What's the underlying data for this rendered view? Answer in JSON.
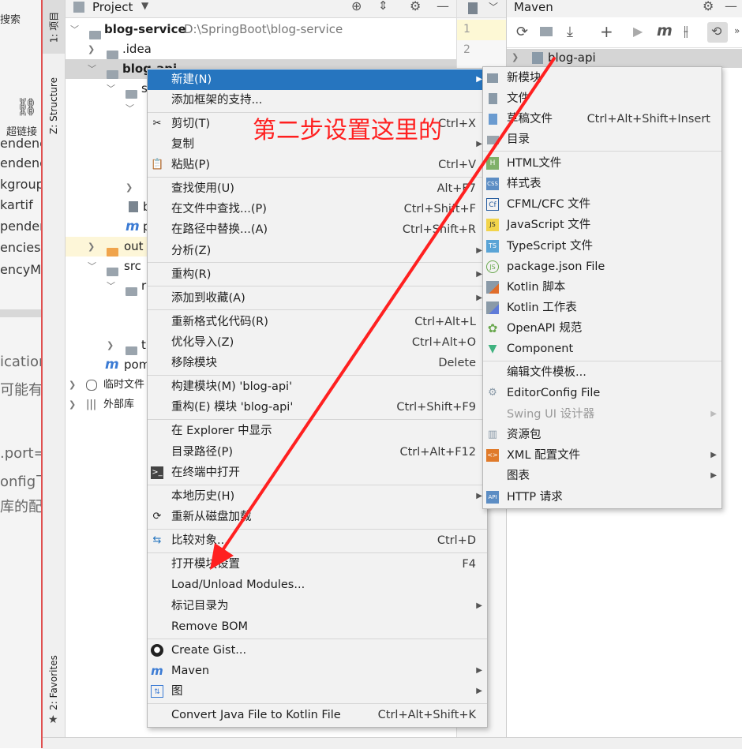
{
  "doc": {
    "lines": [
      "搜索",
      "超链接",
      "endenc",
      "endenc",
      "kgroup",
      "kartif",
      "penden",
      "encies",
      "encyMa",
      "ication",
      "可能有",
      ".port=",
      "onfig下",
      "库的配"
    ]
  },
  "toolstrip": {
    "project_tab": "1: 项目",
    "structure_tab": "Z: Structure",
    "favorites_tab": "2: Favorites"
  },
  "project": {
    "header_title": "Project",
    "tree": [
      {
        "label": "blog-service",
        "path": "D:\\SpringBoot\\blog-service"
      },
      {
        "label": ".idea"
      },
      {
        "label": "blog-api"
      },
      {
        "label": "s"
      },
      {
        "label": "b"
      },
      {
        "label": "p"
      },
      {
        "label": "out"
      },
      {
        "label": "src"
      },
      {
        "label": "r"
      },
      {
        "label": "t"
      },
      {
        "label": "pom"
      },
      {
        "label": "临时文件"
      },
      {
        "label": "外部库"
      }
    ]
  },
  "editor": {
    "line_numbers": [
      "1",
      "2"
    ]
  },
  "maven": {
    "title": "Maven",
    "root_item": "blog-api"
  },
  "annotation": {
    "text": "第二步设置这里的",
    "color": "#ff2020"
  },
  "context_menu": {
    "items": [
      {
        "label": "新建(N)",
        "shortcut": "",
        "submenu": true,
        "selected": true
      },
      {
        "label": "添加框架的支持...",
        "shortcut": ""
      },
      {
        "label": "剪切(T)",
        "shortcut": "Ctrl+X"
      },
      {
        "label": "复制",
        "shortcut": "",
        "submenu": true
      },
      {
        "label": "粘贴(P)",
        "shortcut": "Ctrl+V"
      },
      {
        "label": "查找使用(U)",
        "shortcut": "Alt+F7"
      },
      {
        "label": "在文件中查找...(P)",
        "shortcut": "Ctrl+Shift+F"
      },
      {
        "label": "在路径中替换...(A)",
        "shortcut": "Ctrl+Shift+R"
      },
      {
        "label": "分析(Z)",
        "shortcut": "",
        "submenu": true
      },
      {
        "label": "重构(R)",
        "shortcut": "",
        "submenu": true
      },
      {
        "label": "添加到收藏(A)",
        "shortcut": "",
        "submenu": true
      },
      {
        "label": "重新格式化代码(R)",
        "shortcut": "Ctrl+Alt+L"
      },
      {
        "label": "优化导入(Z)",
        "shortcut": "Ctrl+Alt+O"
      },
      {
        "label": "移除模块",
        "shortcut": "Delete"
      },
      {
        "label": "构建模块(M) 'blog-api'",
        "shortcut": ""
      },
      {
        "label": "重构(E) 模块 'blog-api'",
        "shortcut": "Ctrl+Shift+F9"
      },
      {
        "label": "在 Explorer 中显示",
        "shortcut": ""
      },
      {
        "label": "目录路径(P)",
        "shortcut": "Ctrl+Alt+F12"
      },
      {
        "label": "在终端中打开",
        "shortcut": ""
      },
      {
        "label": "本地历史(H)",
        "shortcut": "",
        "submenu": true
      },
      {
        "label": "重新从磁盘加载",
        "shortcut": ""
      },
      {
        "label": "比较对象...",
        "shortcut": "Ctrl+D"
      },
      {
        "label": "打开模块设置",
        "shortcut": "F4"
      },
      {
        "label": "Load/Unload Modules...",
        "shortcut": ""
      },
      {
        "label": "标记目录为",
        "shortcut": "",
        "submenu": true
      },
      {
        "label": "Remove BOM",
        "shortcut": ""
      },
      {
        "label": "Create Gist...",
        "shortcut": ""
      },
      {
        "label": "Maven",
        "shortcut": "",
        "submenu": true
      },
      {
        "label": "图",
        "shortcut": "",
        "submenu": true
      },
      {
        "label": "Convert Java File to Kotlin File",
        "shortcut": "Ctrl+Alt+Shift+K"
      }
    ]
  },
  "new_submenu": {
    "items": [
      {
        "label": "新模块",
        "shortcut": ""
      },
      {
        "label": "文件",
        "shortcut": ""
      },
      {
        "label": "草稿文件",
        "shortcut": "Ctrl+Alt+Shift+Insert"
      },
      {
        "label": "目录",
        "shortcut": ""
      },
      {
        "label": "HTML文件",
        "shortcut": ""
      },
      {
        "label": "样式表",
        "shortcut": ""
      },
      {
        "label": "CFML/CFC 文件",
        "shortcut": ""
      },
      {
        "label": "JavaScript 文件",
        "shortcut": ""
      },
      {
        "label": "TypeScript 文件",
        "shortcut": ""
      },
      {
        "label": "package.json File",
        "shortcut": ""
      },
      {
        "label": "Kotlin 脚本",
        "shortcut": ""
      },
      {
        "label": "Kotlin 工作表",
        "shortcut": ""
      },
      {
        "label": "OpenAPI 规范",
        "shortcut": ""
      },
      {
        "label": "Component",
        "shortcut": ""
      },
      {
        "label": "编辑文件模板...",
        "shortcut": ""
      },
      {
        "label": "EditorConfig File",
        "shortcut": ""
      },
      {
        "label": "Swing UI 设计器",
        "shortcut": "",
        "submenu": true,
        "disabled": true
      },
      {
        "label": "资源包",
        "shortcut": ""
      },
      {
        "label": "XML 配置文件",
        "shortcut": "",
        "submenu": true
      },
      {
        "label": "图表",
        "shortcut": "",
        "submenu": true
      },
      {
        "label": "HTTP 请求",
        "shortcut": ""
      }
    ]
  },
  "icons": {
    "cut": "scissors-icon",
    "paste": "clipboard-icon",
    "terminal": "terminal-icon",
    "reload": "reload-icon",
    "compare": "compare-icon",
    "github": "github-icon",
    "maven": "maven-icon",
    "diagram": "diagram-icon"
  }
}
